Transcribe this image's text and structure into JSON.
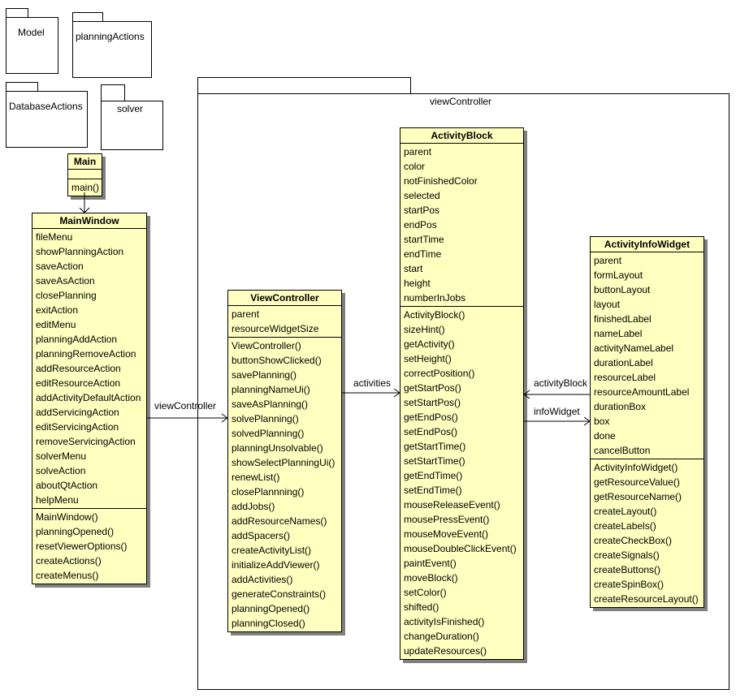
{
  "packages": [
    {
      "name": "Model"
    },
    {
      "name": "planningActions"
    },
    {
      "name": "DatabaseActions"
    },
    {
      "name": "solver"
    },
    {
      "name": "viewController"
    }
  ],
  "classes": {
    "main": {
      "name": "Main",
      "attributes": [],
      "methods": [
        "main()"
      ]
    },
    "mainwindow": {
      "name": "MainWindow",
      "attributes": [
        "fileMenu",
        "showPlanningAction",
        "saveAction",
        "saveAsAction",
        "closePlanning",
        "exitAction",
        "editMenu",
        "planningAddAction",
        "planningRemoveAction",
        "addResourceAction",
        "editResourceAction",
        "addActivityDefaultAction",
        "addServicingAction",
        "editServicingAction",
        "removeServicingAction",
        "solverMenu",
        "solveAction",
        "aboutQtAction",
        "helpMenu"
      ],
      "methods": [
        "MainWindow()",
        "planningOpened()",
        "resetViewerOptions()",
        "createActions()",
        "createMenus()"
      ]
    },
    "viewcontroller": {
      "name": "ViewController",
      "attributes": [
        "parent",
        "resourceWidgetSize"
      ],
      "methods": [
        "ViewController()",
        "buttonShowClicked()",
        "savePlanning()",
        "planningNameUi()",
        "saveAsPlanning()",
        "solvePlanning()",
        "solvedPlanning()",
        "planningUnsolvable()",
        "showSelectPlanningUi()",
        "renewList()",
        "closePlannning()",
        "addJobs()",
        "addResourceNames()",
        "addSpacers()",
        "createActivityList()",
        "initializeAddViewer()",
        "addActivities()",
        "generateConstraints()",
        "planningOpened()",
        "planningClosed()"
      ]
    },
    "activityblock": {
      "name": "ActivityBlock",
      "attributes": [
        "parent",
        "color",
        "notFinishedColor",
        "selected",
        "startPos",
        "endPos",
        "startTime",
        "endTime",
        "start",
        "height",
        "numberInJobs"
      ],
      "methods": [
        "ActivityBlock()",
        "sizeHint()",
        "getActivity()",
        "setHeight()",
        "correctPosition()",
        "getStartPos()",
        "setStartPos()",
        "getEndPos()",
        "setEndPos()",
        "getStartTime()",
        "setStartTime()",
        "getEndTime()",
        "setEndTime()",
        "mouseReleaseEvent()",
        "mousePressEvent()",
        "mouseMoveEvent()",
        "mouseDoubleClickEvent()",
        "paintEvent()",
        "moveBlock()",
        "setColor()",
        "shifted()",
        "activityIsFinished()",
        "changeDuration()",
        "updateResources()"
      ]
    },
    "activityinfowidget": {
      "name": "ActivityInfoWidget",
      "attributes": [
        "parent",
        "formLayout",
        "buttonLayout",
        "layout",
        "finishedLabel",
        "nameLabel",
        "activityNameLabel",
        "durationLabel",
        "resourceLabel",
        "resourceAmountLabel",
        "durationBox",
        "box",
        "done",
        "cancelButton"
      ],
      "methods": [
        "ActivityInfoWidget()",
        "getResourceValue()",
        "getResourceName()",
        "createLayout()",
        "createLabels()",
        "createCheckBox()",
        "createSignals()",
        "createButtons()",
        "createSpinBox()",
        "createResourceLayout()"
      ]
    }
  },
  "associations": [
    {
      "from": "Main",
      "to": "MainWindow",
      "label": ""
    },
    {
      "from": "MainWindow",
      "to": "ViewController",
      "label": "viewController"
    },
    {
      "from": "ViewController",
      "to": "ActivityBlock",
      "label": "activities"
    },
    {
      "from": "ActivityInfoWidget",
      "to": "ActivityBlock",
      "label": "activityBlock"
    },
    {
      "from": "ActivityBlock",
      "to": "ActivityInfoWidget",
      "label": "infoWidget"
    }
  ],
  "colors": {
    "class_fill": "#ffffc0",
    "shadow": "#808080",
    "line": "#000000"
  }
}
